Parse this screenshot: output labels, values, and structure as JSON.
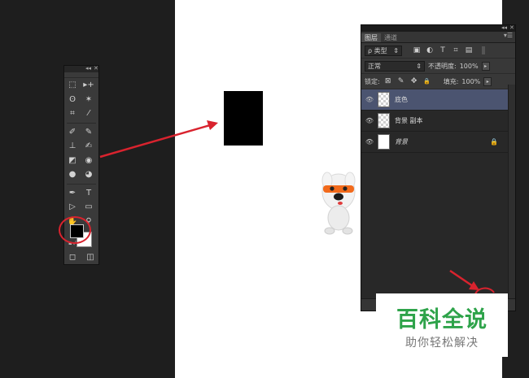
{
  "tools_panel": {
    "collapse": "◂◂",
    "close": "✕",
    "rows": [
      [
        "⬚",
        "▸+"
      ],
      [
        "ʘ",
        "✶"
      ],
      [
        "⌗",
        "⁄"
      ],
      [
        "✐",
        "✎"
      ],
      [
        "⊥",
        "✍"
      ],
      [
        "◩",
        "◉"
      ],
      [
        "●",
        "◕"
      ],
      [
        "✒",
        "T"
      ],
      [
        "▷",
        "▭"
      ],
      [
        "✋",
        "⚲"
      ]
    ],
    "bottom": [
      "◻",
      "◫"
    ],
    "swatch_mini": "▪↲"
  },
  "layers_panel": {
    "collapse": "◂◂",
    "close": "✕",
    "tabs": [
      {
        "label": "图层",
        "active": true
      },
      {
        "label": "通道",
        "active": false
      }
    ],
    "menu": "▾☰",
    "filter": {
      "label": "ρ 类型",
      "arrow": "⇕",
      "icons": [
        "▣",
        "◐",
        "T",
        "⌗",
        "▤"
      ]
    },
    "blend": {
      "mode": "正常",
      "arrow": "⇕",
      "opacity_label": "不透明度:",
      "opacity_value": "100%",
      "stepper": "▸"
    },
    "lock": {
      "label": "锁定:",
      "icons": [
        "⊠",
        "✎",
        "✥",
        "🔒"
      ],
      "fill_label": "填充:",
      "fill_value": "100%",
      "stepper": "▸"
    },
    "layers": [
      {
        "name": "底色",
        "visible_icon": "👁",
        "selected": true,
        "thumb": "checker",
        "italic": false,
        "locked": false
      },
      {
        "name": "背景 副本",
        "visible_icon": "👁",
        "selected": false,
        "thumb": "checker",
        "italic": false,
        "locked": false
      },
      {
        "name": "背景",
        "visible_icon": "👁",
        "selected": false,
        "thumb": "white",
        "italic": true,
        "locked": true,
        "lock_icon": "🔒"
      }
    ]
  },
  "watermark": {
    "title": "百科全说",
    "subtitle": "助你轻松解决",
    "color": "#2ea34a"
  },
  "annotation_color": "#d9232e"
}
